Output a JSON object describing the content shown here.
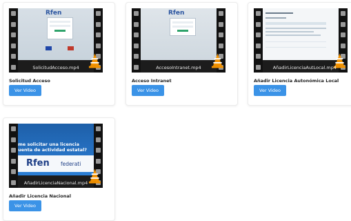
{
  "videos": [
    {
      "filename": "SolicitudAcceso.mp4",
      "title": "Solicitud Acceso",
      "button_label": "Ver Video"
    },
    {
      "filename": "AccesoIntranet.mp4",
      "title": "Acceso Intranet",
      "button_label": "Ver Video"
    },
    {
      "filename": "AñadirLicenciaAutLocal.mp4",
      "title": "Añadir Licencia Autonómica Local",
      "button_label": "Ver Video"
    },
    {
      "filename": "AñadirLicenciaNacional.mp4",
      "title": "Añadir Licencia Nacional",
      "button_label": "Ver Video"
    }
  ],
  "thumbnail_texts": {
    "logo": "Rfen",
    "logo_small": "Rfen",
    "question_line1": "me solicitar una licencia",
    "question_line2": "uenta de actividad estatal?",
    "federation": "federati"
  },
  "colors": {
    "button": "#3b93e7",
    "film": "#111111",
    "cone": "#f39200"
  }
}
